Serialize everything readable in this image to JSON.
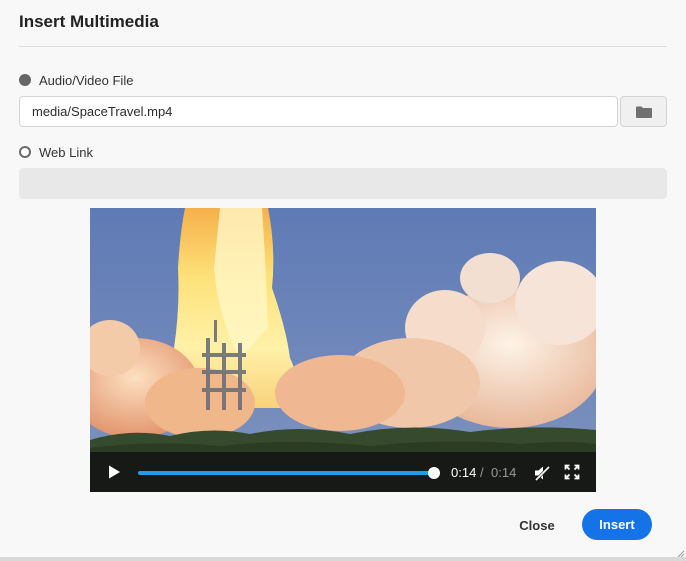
{
  "dialog": {
    "title": "Insert Multimedia"
  },
  "source": {
    "file_option": {
      "label": "Audio/Video File",
      "selected": true
    },
    "file_path": "media/SpaceTravel.mp4",
    "browse_icon": "folder-icon",
    "web_option": {
      "label": "Web Link",
      "selected": false
    },
    "web_url": ""
  },
  "player": {
    "current_time": "0:14",
    "separator": "/",
    "duration": "0:14",
    "progress": 1.0,
    "icons": {
      "play": "play-icon",
      "mute": "speaker-muted-icon",
      "fullscreen": "fullscreen-icon"
    },
    "accent_color": "#1ea0e6"
  },
  "actions": {
    "close_label": "Close",
    "insert_label": "Insert",
    "insert_color": "#1473e6"
  }
}
